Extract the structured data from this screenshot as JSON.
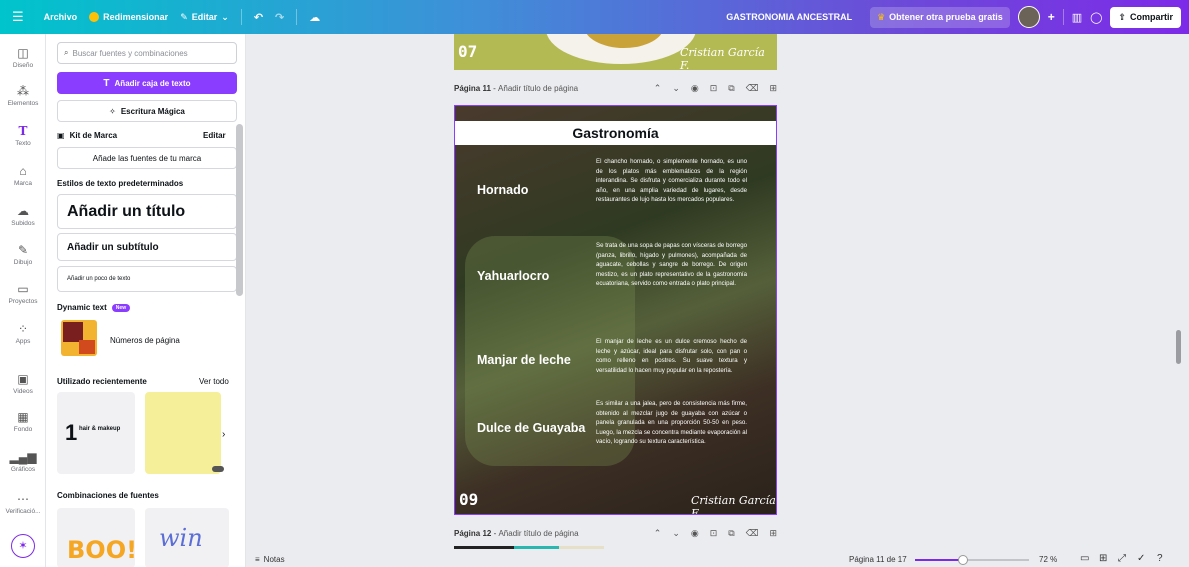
{
  "topbar": {
    "menu_icon": "hamburger-icon",
    "file_label": "Archivo",
    "resize_label": "Redimensionar",
    "edit_label": "Editar",
    "doc_title": "GASTRONOMIA ANCESTRAL",
    "trial_label": "Obtener otra prueba gratis",
    "share_label": "Compartir"
  },
  "rail": [
    {
      "label": "Diseño",
      "icon": "layout-icon"
    },
    {
      "label": "Elementos",
      "icon": "elements-icon"
    },
    {
      "label": "Texto",
      "icon": "text-icon"
    },
    {
      "label": "Marca",
      "icon": "brand-icon"
    },
    {
      "label": "Subidos",
      "icon": "upload-icon"
    },
    {
      "label": "Dibujo",
      "icon": "draw-icon"
    },
    {
      "label": "Proyectos",
      "icon": "folder-icon"
    },
    {
      "label": "Apps",
      "icon": "apps-icon"
    },
    {
      "label": "Videos",
      "icon": "video-icon"
    },
    {
      "label": "Fondo",
      "icon": "background-icon"
    },
    {
      "label": "Gráficos",
      "icon": "chart-icon"
    },
    {
      "label": "Verificació...",
      "icon": "verify-icon"
    }
  ],
  "panel": {
    "search_placeholder": "Buscar fuentes y combinaciones",
    "add_textbox": "Añadir caja de texto",
    "magic_write": "Escritura Mágica",
    "brand_kit": "Kit de Marca",
    "brand_edit": "Editar",
    "brand_fonts": "Añade las fuentes de tu marca",
    "default_styles": "Estilos de texto predeterminados",
    "add_title": "Añadir un título",
    "add_subtitle": "Añadir un subtítulo",
    "add_body": "Añadir un poco de texto",
    "dynamic_text": "Dynamic text",
    "new_badge": "New",
    "page_numbers": "Números de página",
    "recent": "Utilizado recientemente",
    "see_all": "Ver todo",
    "recent_card_1": "hair & makeup",
    "combos": "Combinaciones de fuentes",
    "combo_1": "BOO!",
    "combo_2": "win"
  },
  "canvas": {
    "prev_page_number": "07",
    "signature": "Cristian García F.",
    "page11_label": "Página 11",
    "page11_title_hint": "Añadir título de página",
    "page12_label": "Página 12",
    "page12_title_hint": "Añadir título de página",
    "page": {
      "heading": "Gastronomía",
      "page_number": "09",
      "items": [
        {
          "name": "Hornado",
          "text": "El chancho hornado, o simplemente hornado, es uno de los platos más emblemáticos de la región interandina. Se disfruta y comercializa durante todo el año, en una amplia variedad de lugares, desde restaurantes de lujo hasta los mercados populares."
        },
        {
          "name": "Yahuarlocro",
          "text": "Se trata de una sopa de papas con vísceras de borrego (panza, librillo, hígado y pulmones), acompañada de aguacate, cebollas y sangre de borrego. De origen mestizo, es un plato representativo de la gastronomía ecuatoriana, servido como entrada o plato principal."
        },
        {
          "name": "Manjar de leche",
          "text": "El manjar de leche es un dulce cremoso hecho de leche y azúcar, ideal para disfrutar solo, con pan o como relleno en postres. Su suave textura y versatilidad lo hacen muy popular en la repostería."
        },
        {
          "name": "Dulce de Guayaba",
          "text": "Es similar a una jalea, pero de consistencia más firme, obtenido al mezclar jugo de guayaba con azúcar o panela granulada en una proporción 50-50 en peso. Luego, la mezcla se concentra mediante evaporación al vacío, logrando su textura característica."
        }
      ]
    }
  },
  "bottombar": {
    "notes": "Notas",
    "page_indicator": "Página 11 de 17",
    "zoom": "72 %",
    "zoom_fraction": 0.42
  }
}
